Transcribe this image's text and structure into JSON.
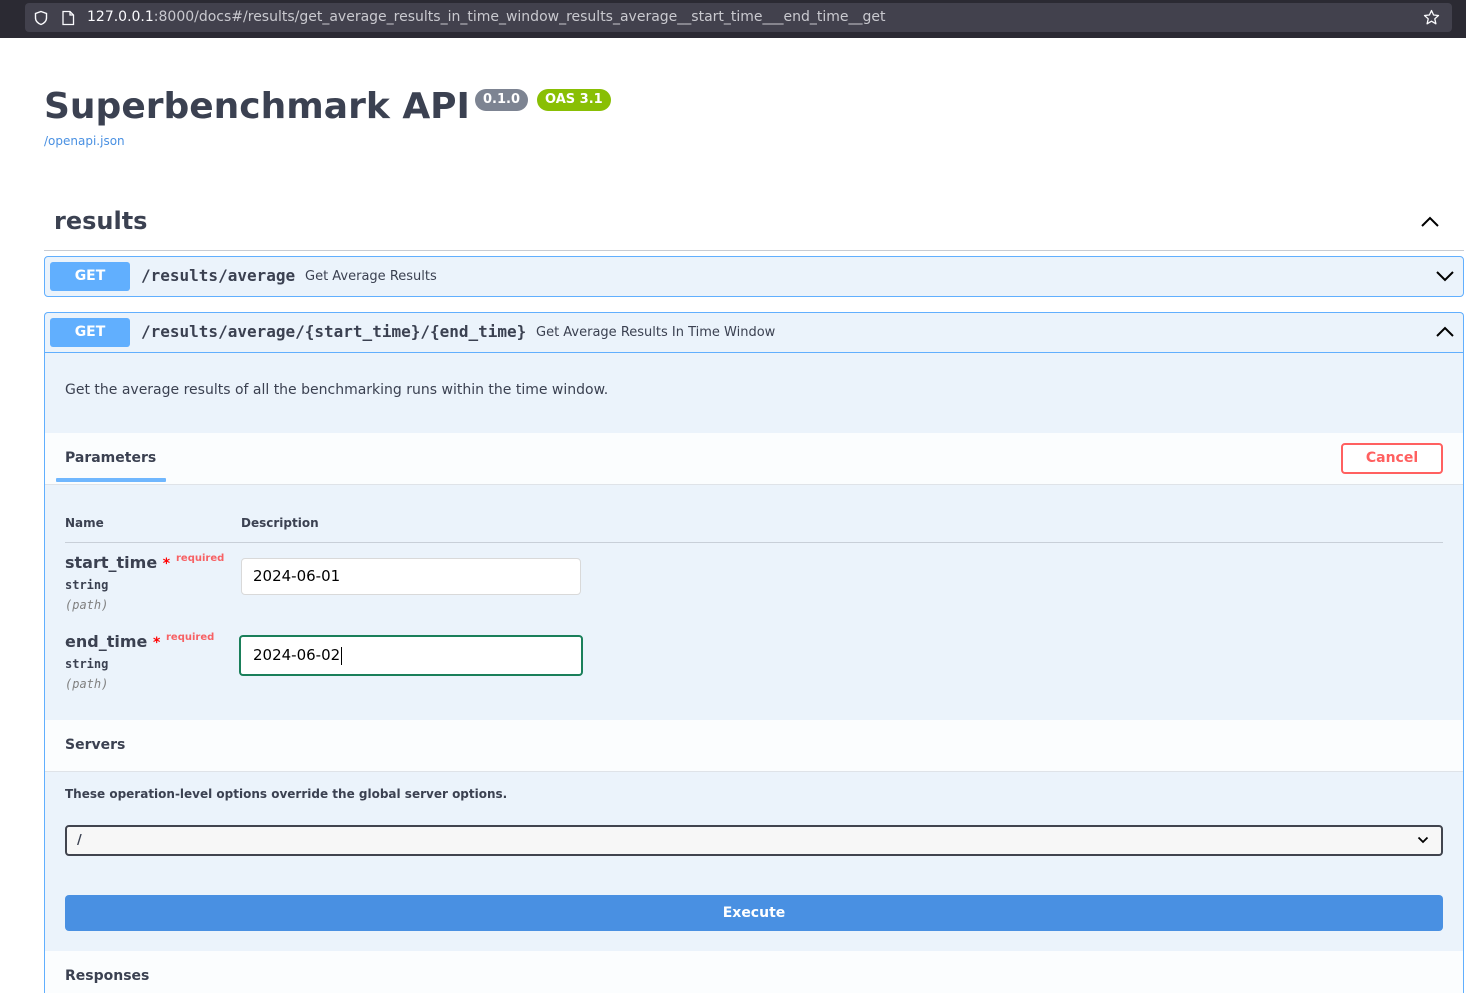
{
  "browser": {
    "url_host": "127.0.0.1",
    "url_rest": ":8000/docs#/results/get_average_results_in_time_window_results_average__start_time___end_time__get"
  },
  "info": {
    "title": "Superbenchmark API",
    "version": "0.1.0",
    "oas": "OAS 3.1",
    "openapi_link": "/openapi.json"
  },
  "tag": {
    "name": "results"
  },
  "operations": [
    {
      "method": "GET",
      "path": "/results/average",
      "summary": "Get Average Results",
      "expanded": false
    },
    {
      "method": "GET",
      "path": "/results/average/{start_time}/{end_time}",
      "summary": "Get Average Results In Time Window",
      "expanded": true,
      "description": "Get the average results of all the benchmarking runs within the time window."
    }
  ],
  "parameters": {
    "tab_label": "Parameters",
    "cancel_label": "Cancel",
    "col_name": "Name",
    "col_description": "Description",
    "items": [
      {
        "name": "start_time",
        "star": "*",
        "required": "required",
        "type": "string",
        "in": "(path)",
        "value": "2024-06-01"
      },
      {
        "name": "end_time",
        "star": "*",
        "required": "required",
        "type": "string",
        "in": "(path)",
        "value": "2024-06-02"
      }
    ]
  },
  "servers": {
    "title": "Servers",
    "note": "These operation-level options override the global server options.",
    "selected": "/"
  },
  "execute_label": "Execute",
  "responses_title": "Responses",
  "colors": {
    "get_blue": "#61affe",
    "execute_blue": "#4990e2",
    "cancel_red": "#ff6060",
    "oas_green": "#89bf04",
    "version_gray": "#7d8492",
    "focus_green": "#1a7f5a"
  }
}
